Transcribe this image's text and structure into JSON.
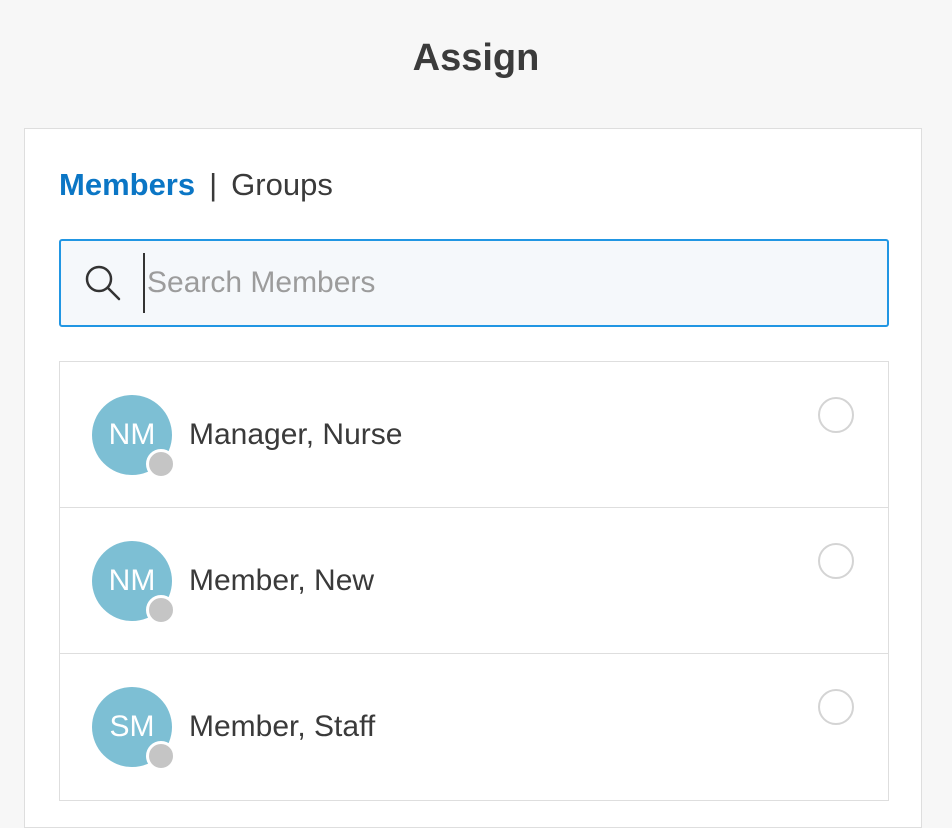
{
  "header": {
    "title": "Assign"
  },
  "tabs": {
    "members_label": "Members",
    "separator": "|",
    "groups_label": "Groups",
    "active": "Members"
  },
  "search": {
    "placeholder": "Search Members",
    "value": "",
    "icon": "search-icon"
  },
  "members": [
    {
      "initials": "NM",
      "name": "Manager, Nurse",
      "selected": false,
      "status": "offline"
    },
    {
      "initials": "NM",
      "name": "Member, New",
      "selected": false,
      "status": "offline"
    },
    {
      "initials": "SM",
      "name": "Member, Staff",
      "selected": false,
      "status": "offline"
    }
  ],
  "colors": {
    "accent": "#0b76c5",
    "search_border": "#2196e3",
    "avatar": "#7dbfd4",
    "status_offline": "#c5c5c5"
  }
}
